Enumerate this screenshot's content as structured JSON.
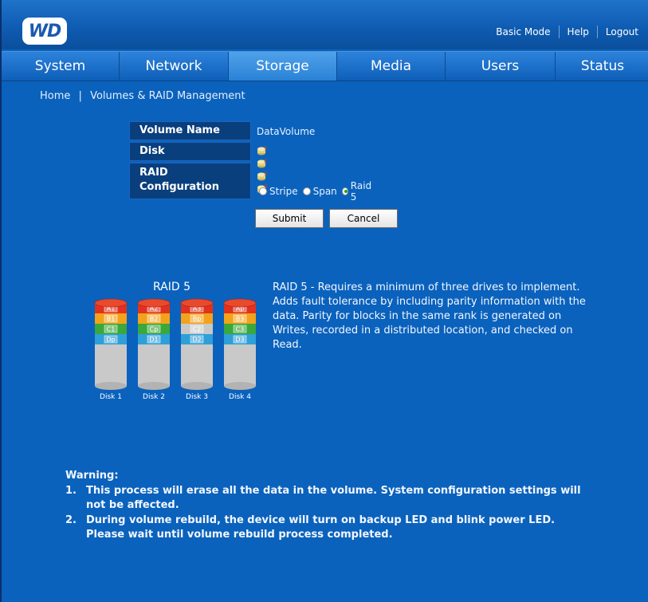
{
  "header": {
    "logo_text": "WD",
    "links": [
      "Basic Mode",
      "Help",
      "Logout"
    ]
  },
  "tabs": [
    {
      "label": "System",
      "active": false
    },
    {
      "label": "Network",
      "active": false
    },
    {
      "label": "Storage",
      "active": true
    },
    {
      "label": "Media",
      "active": false
    },
    {
      "label": "Users",
      "active": false
    },
    {
      "label": "Status",
      "active": false
    }
  ],
  "breadcrumb": {
    "home": "Home",
    "separator": "|",
    "current": "Volumes & RAID Management"
  },
  "form": {
    "volume_name_label": "Volume Name",
    "volume_name_value": "DataVolume",
    "disk_label": "Disk",
    "disk_icons": [
      "disk-1-icon",
      "disk-2-icon",
      "disk-3-icon",
      "disk-4-icon"
    ],
    "raid_label_line1": "RAID",
    "raid_label_line2": "Configuration",
    "raid_options": [
      {
        "label": "Stripe",
        "selected": false
      },
      {
        "label": "Span",
        "selected": false
      },
      {
        "label": "Raid 5",
        "selected": true
      }
    ],
    "submit_label": "Submit",
    "cancel_label": "Cancel"
  },
  "diagram": {
    "title": "RAID 5",
    "disks": [
      {
        "label": "Disk 1",
        "blocks": [
          "A1",
          "B1",
          "C1",
          "Dp"
        ]
      },
      {
        "label": "Disk 2",
        "blocks": [
          "A2",
          "B2",
          "Cp",
          "D1"
        ]
      },
      {
        "label": "Disk 3",
        "blocks": [
          "A3",
          "Bp",
          "C2",
          "D2"
        ]
      },
      {
        "label": "Disk 4",
        "blocks": [
          "Ap",
          "B3",
          "C3",
          "D3"
        ]
      }
    ],
    "colors": {
      "a": "#e0321f",
      "b": "#f3a21b",
      "c": "#3aa83a",
      "d": "#2f9fd8",
      "c_parity_disk3": "#c8c8c8"
    }
  },
  "description": "RAID 5 - Requires a minimum of three drives to implement. Adds fault tolerance by including parity information with the data. Parity for blocks in the same rank is generated on Writes, recorded in a distributed location, and checked on Read.",
  "warning": {
    "title": "Warning:",
    "items": [
      {
        "num": "1.",
        "line1": "This process will erase all the data in the volume. System configuration settings will",
        "line2": "not be affected."
      },
      {
        "num": "2.",
        "line1": "During volume rebuild, the device will turn on backup LED and blink power LED.",
        "line2": "Please wait until volume rebuild process completed."
      }
    ]
  }
}
